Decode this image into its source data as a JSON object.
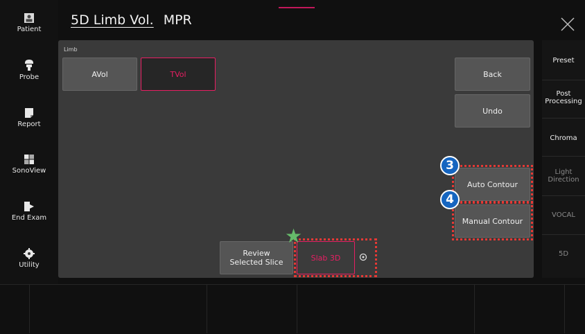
{
  "header": {
    "title": "5D Limb Vol.",
    "subtitle": "MPR"
  },
  "left_nav": [
    {
      "label": "Patient",
      "icon": "patient-icon"
    },
    {
      "label": "Probe",
      "icon": "probe-icon"
    },
    {
      "label": "Report",
      "icon": "report-icon"
    },
    {
      "label": "SonoView",
      "icon": "sonoview-icon"
    },
    {
      "label": "End Exam",
      "icon": "end-exam-icon"
    },
    {
      "label": "Utility",
      "icon": "utility-icon"
    }
  ],
  "panel": {
    "label": "Limb",
    "avol_label": "AVol",
    "tvol_label": "TVol",
    "back_label": "Back",
    "undo_label": "Undo",
    "auto_contour_label": "Auto Contour",
    "manual_contour_label": "Manual Contour",
    "review_line1": "Review",
    "review_line2": "Selected Slice",
    "slab3d_label": "Slab 3D"
  },
  "right_nav": [
    {
      "label": "Preset",
      "active": true
    },
    {
      "label": "Post Processing",
      "active": true
    },
    {
      "label": "Chroma",
      "active": true
    },
    {
      "label": "Light Direction",
      "active": false
    },
    {
      "label": "VOCAL",
      "active": false
    },
    {
      "label": "5D",
      "active": false
    }
  ],
  "annotations": {
    "marker_3": "3",
    "marker_4": "4"
  },
  "colors": {
    "accent_pink": "#e91e63",
    "annotation_red": "#e53935",
    "annotation_blue": "#1565c0",
    "star_green": "#66bb6a"
  }
}
